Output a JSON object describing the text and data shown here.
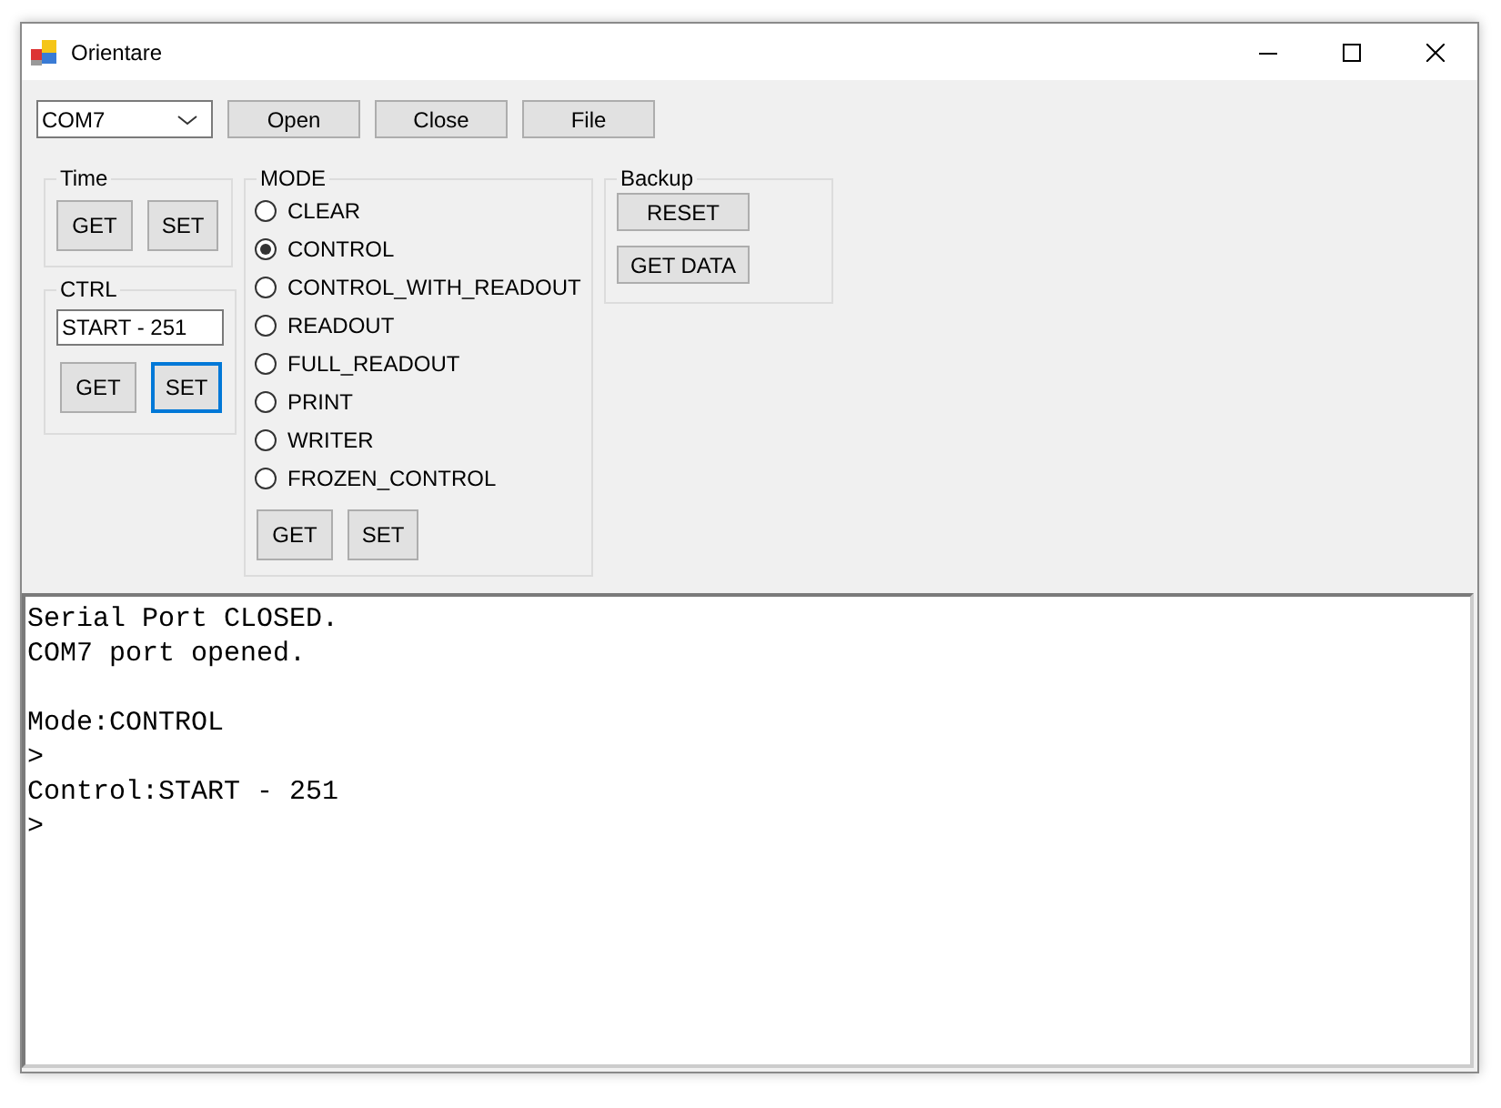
{
  "window": {
    "title": "Orientare"
  },
  "toolbar": {
    "port": {
      "value": "COM7"
    },
    "buttons": [
      {
        "label": "Open",
        "focused": false
      },
      {
        "label": "Close",
        "focused": false
      },
      {
        "label": "File",
        "focused": false
      }
    ]
  },
  "time_group": {
    "title": "Time",
    "buttons": [
      {
        "label": "GET",
        "focused": false
      },
      {
        "label": "SET",
        "focused": false
      }
    ]
  },
  "ctrl_group": {
    "title": "CTRL",
    "value": "START - 251",
    "buttons": [
      {
        "label": "GET",
        "focused": false
      },
      {
        "label": "SET",
        "focused": true
      }
    ]
  },
  "mode_group": {
    "title": "MODE",
    "options": [
      {
        "label": "CLEAR",
        "selected": false
      },
      {
        "label": "CONTROL",
        "selected": true
      },
      {
        "label": "CONTROL_WITH_READOUT",
        "selected": false
      },
      {
        "label": "READOUT",
        "selected": false
      },
      {
        "label": "FULL_READOUT",
        "selected": false
      },
      {
        "label": "PRINT",
        "selected": false
      },
      {
        "label": "WRITER",
        "selected": false
      },
      {
        "label": "FROZEN_CONTROL",
        "selected": false
      }
    ],
    "buttons": [
      {
        "label": "GET",
        "focused": false
      },
      {
        "label": "SET",
        "focused": false
      }
    ]
  },
  "backup_group": {
    "title": "Backup",
    "buttons": [
      {
        "label": "RESET",
        "focused": false
      },
      {
        "label": "GET DATA",
        "focused": false
      }
    ]
  },
  "console": {
    "text": "Serial Port CLOSED.\nCOM7 port opened.\n\nMode:CONTROL\n>\nControl:START - 251\n>"
  }
}
